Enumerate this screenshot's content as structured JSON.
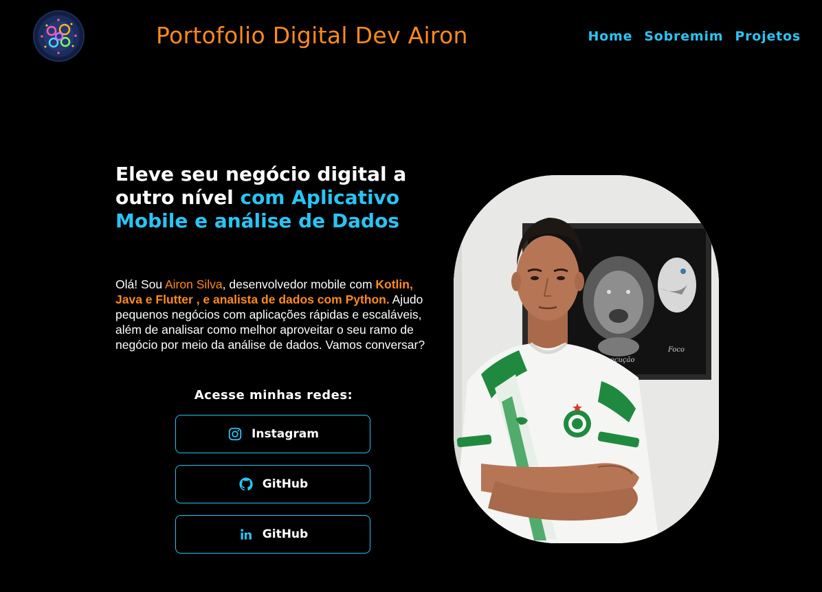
{
  "header": {
    "logo_alt": "logo",
    "title": "Portofolio Digital Dev Airon",
    "nav": [
      {
        "label": "Home"
      },
      {
        "label": "Sobremim"
      },
      {
        "label": "Projetos"
      }
    ]
  },
  "hero": {
    "headline_white": "Eleve seu negócio digital a outro nível",
    "headline_accent": "com Aplicativo Mobile e análise de Dados",
    "intro": {
      "part1": "Olá! Sou ",
      "name": "Airon Silva",
      "part2": ", desenvolvedor mobile com ",
      "skills": "Kotlin, Java e Flutter , e analista de dados com Python.",
      "part3": " Ajudo pequenos negócios com aplicações rápidas e escaláveis, além de analisar como melhor aproveitar o seu ramo de negócio por meio da análise de dados. Vamos conversar?"
    },
    "socials_title": "Acesse minhas redes:",
    "socials": [
      {
        "label": "Instagram",
        "icon": "instagram-icon"
      },
      {
        "label": "GitHub",
        "icon": "github-icon"
      },
      {
        "label": "GitHub",
        "icon": "linkedin-icon"
      }
    ]
  },
  "colors": {
    "background": "#000000",
    "orange": "#ff8a1c",
    "cyan": "#29c4f5",
    "white": "#ffffff"
  }
}
